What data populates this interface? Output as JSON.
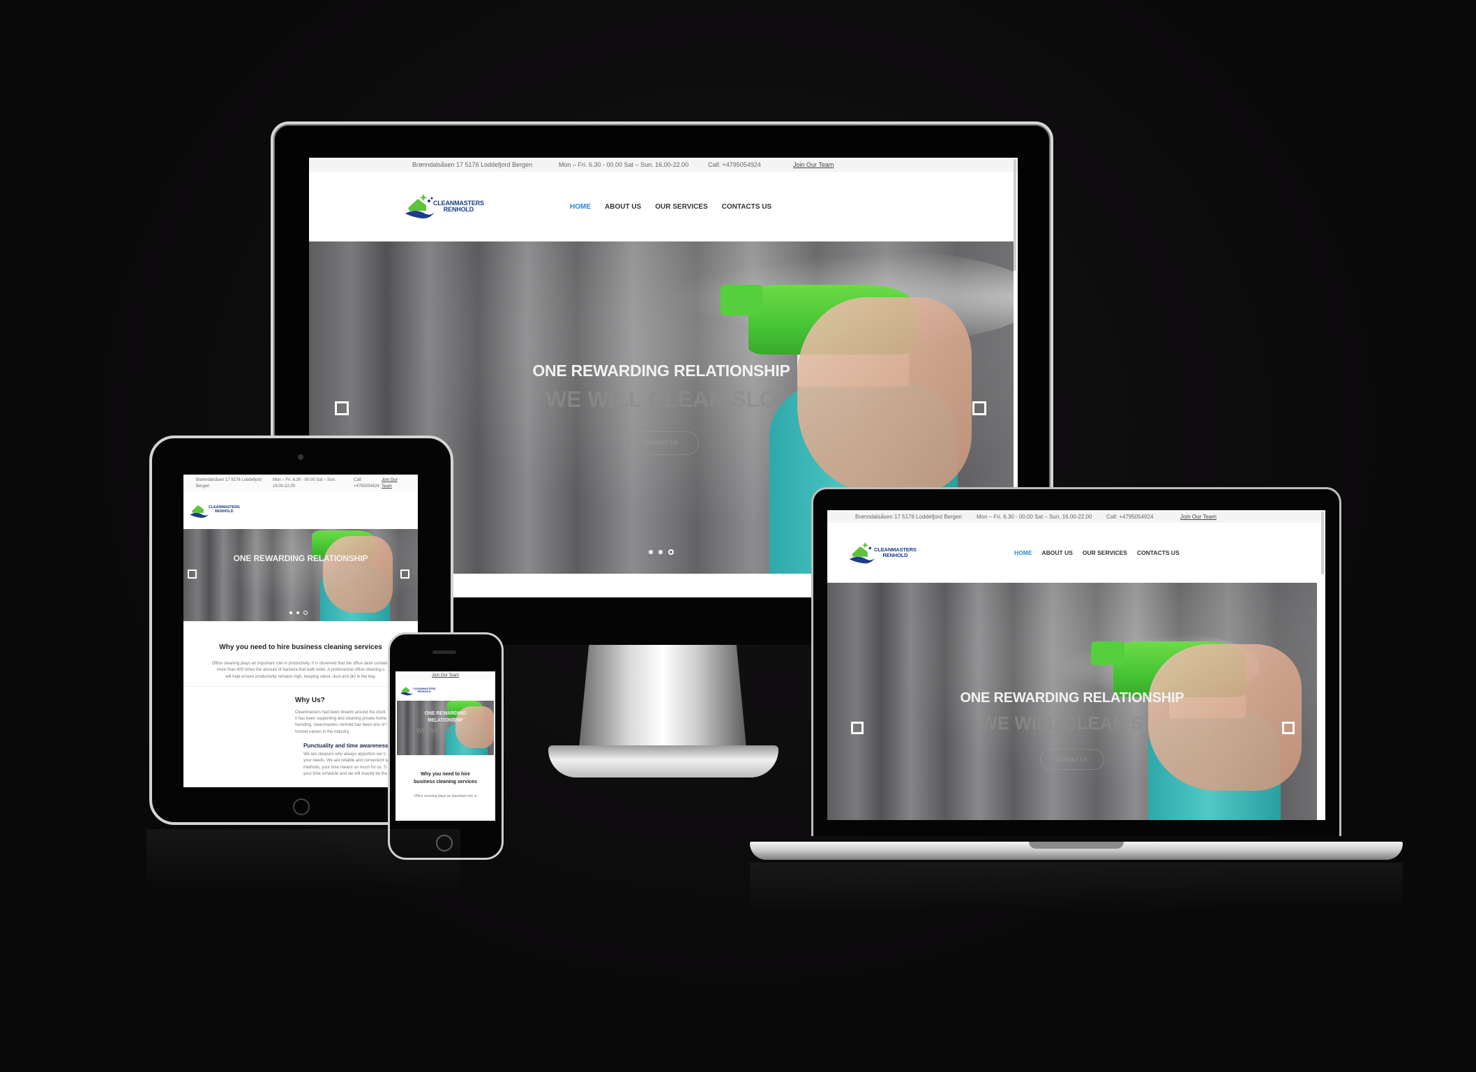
{
  "site": {
    "topbar": {
      "address": "Brønndalsåsen 17 5176 Loddefjord Bergen",
      "hours": "Mon – Fri. 6.30 - 00.00 Sat – Sun. 16.00-22.00",
      "phone": "Call: +4795054924",
      "join": "Join Our Team"
    },
    "logo": {
      "line1": "CLEANMASTERS",
      "line2": "RENHOLD"
    },
    "nav": {
      "home": "HOME",
      "about": "ABOUT US",
      "services": "OUR SERVICES",
      "contacts": "CONTACTS US"
    },
    "hero": {
      "title": "ONE REWARDING RELATIONSHIP",
      "subtitle_desktop": "WE WILL CLEAN SLO",
      "subtitle_laptop": "WE WILL CLEAN S",
      "button": "Contact Us",
      "slides_total": 3,
      "active_slide": 3
    },
    "tablet": {
      "address_l1": "Brønndalsåsen 17 5176 Loddefjord",
      "address_l2": "Bergen",
      "hours_l1": "Mon – Fri. 6.30 - 00.00 Sat – Sun.",
      "hours_l2": "16.00-22.00",
      "phone_l1": "Call:",
      "phone_l2": "+4795054924",
      "join_l1": "Join Our",
      "join_l2": "Team",
      "section_title": "Why you need to hire business cleaning services",
      "section_text_1": "Office cleaning plays an important role in productivity. It is observed that the office desk contains",
      "section_text_2": "more than 400 times the amount of bacteria that bath toilet. A professional office cleaning s",
      "section_text_3": "will help ensure productivity remains high, keeping odour, dust and dirt in the bay.",
      "why_title": "Why Us?",
      "why_text_1": "Cleanmasters had been dreamt around the clock",
      "why_text_2": "it has been supporting and cleaning private home",
      "why_text_3": "founding, cleanmasters renhold has been one of t",
      "why_text_4": "trusted names in the industry.",
      "punct_title": "Punctuality and time awareness",
      "punct_text_1": "We are cleaners who always apportion our ti",
      "punct_text_2": "your needs. We are reliable and convenient w",
      "punct_text_3": "methods, your time means so much for us. S",
      "punct_text_4": "your time schedule and we will exactly be the"
    },
    "phone": {
      "join": "Join Our Team",
      "hero_l1": "ONE REWARDING",
      "hero_l2": "RELATIONSHIP",
      "hero_sub": "WE WILL CL",
      "section_l1": "Why you need to hire",
      "section_l2": "business cleaning services",
      "text_1": "Office cleaning plays an important role in"
    }
  },
  "colors": {
    "background": "#0a090a",
    "accent": "#2d8ac9",
    "logo_blue": "#1b3e86",
    "logo_green": "#5cc33a"
  },
  "icons": {
    "slider_prev": "square-outline-icon",
    "slider_next": "square-outline-icon",
    "pagination": "dot-icon"
  }
}
